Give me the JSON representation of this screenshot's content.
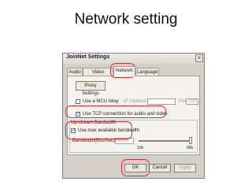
{
  "slide": {
    "title": "Network setting"
  },
  "dialog": {
    "title": "JoinNet Settings",
    "close_glyph": "×",
    "tabs": [
      {
        "label": "Audio",
        "active": false
      },
      {
        "label": "Video Options",
        "active": false
      },
      {
        "label": "Network",
        "active": true
      },
      {
        "label": "Language",
        "active": false
      }
    ],
    "network": {
      "proxy_button": "Proxy Settings",
      "mcu_relay": {
        "label": "Use a MCU relay",
        "checked": false
      },
      "ip_address_label": "IP Address",
      "port_label": "Port",
      "port_value": "2333",
      "tcp": {
        "label": "Use TCP connection for audio and video",
        "checked": true
      },
      "upstream": {
        "group_label": "Up-stream Bandwidth",
        "use_max": {
          "label": "Use max available bandwidth",
          "checked": true
        },
        "bandwidth_label": "Bandwidth(Bits/Sec)",
        "bandwidth_value": "96000",
        "slider_min": "10k",
        "slider_max": "96k",
        "slider_level": 1.0
      }
    },
    "buttons": {
      "ok": "OK",
      "cancel": "Cancel",
      "apply": "Apply"
    }
  }
}
